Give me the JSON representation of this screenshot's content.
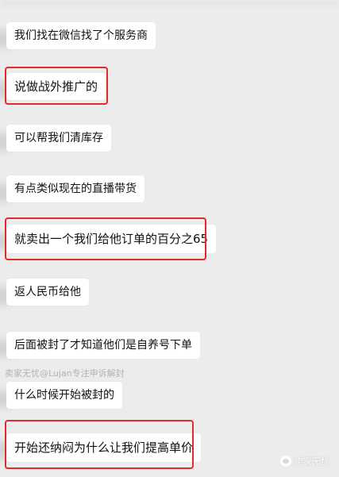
{
  "messages": [
    {
      "text": "我们找在微信找了个服务商",
      "highlighted": false
    },
    {
      "text": "说做战外推广的",
      "highlighted": true
    },
    {
      "text": "可以帮我们清库存",
      "highlighted": false
    },
    {
      "text": "有点类似现在的直播带货",
      "highlighted": false
    },
    {
      "text": "就卖出一个我们给他订单的百分之65",
      "highlighted": true
    },
    {
      "text": "返人民币给他",
      "highlighted": false
    },
    {
      "text": "后面被封了才知道他们是自养号下单",
      "highlighted": false
    },
    {
      "text": "什么时候开始被封的",
      "highlighted": false
    },
    {
      "text": "开始还纳闷为什么让我们提高单价",
      "highlighted": true
    }
  ],
  "sender_label": "卖家无忧@Lujan专注申诉解封",
  "watermark": {
    "text": "卖家无忧"
  },
  "colors": {
    "highlight": "#e32a2a",
    "background": "#ececec",
    "bubble": "#ffffff"
  }
}
